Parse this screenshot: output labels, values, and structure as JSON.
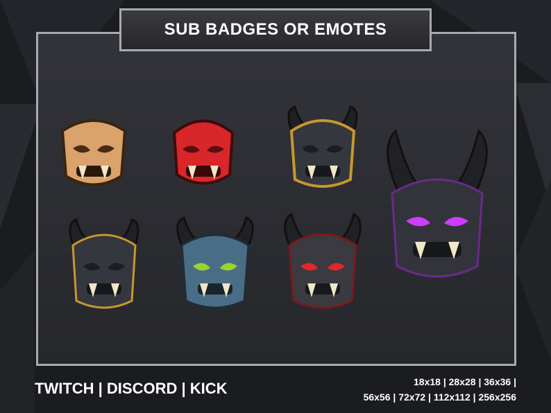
{
  "title": "SUB BADGES OR EMOTES",
  "platforms": "TWITCH | DISCORD | KICK",
  "sizes_line1": "18x18 | 28x28 | 36x36 |",
  "sizes_line2": "56x56 | 72x72 | 112x112 | 256x256",
  "colors": {
    "background": "#1b1c20",
    "panel_border": "#a9abb0",
    "text": "#ffffff"
  },
  "masks": [
    {
      "name": "tan-oni-mask",
      "skin": "#d9a36b",
      "eyes": "#4a2a12",
      "horns": false
    },
    {
      "name": "red-oni-mask",
      "skin": "#d8262a",
      "eyes": "#5a0e10",
      "horns": false
    },
    {
      "name": "gold-trim-oni-helmet",
      "skin": "#34373d",
      "eyes": "#1c1d21",
      "horns": true
    },
    {
      "name": "black-oni-helmet",
      "skin": "#34373d",
      "eyes": "#1c1d21",
      "horns": true
    },
    {
      "name": "blue-oni-helmet",
      "skin": "#4a6d86",
      "eyes": "#9bd22d",
      "horns": true
    },
    {
      "name": "red-eye-oni-helmet",
      "skin": "#3a3a40",
      "eyes": "#e0272b",
      "horns": true
    },
    {
      "name": "purple-oni-helmet",
      "skin": "#33343b",
      "eyes": "#cf3dff",
      "horns": true
    }
  ]
}
